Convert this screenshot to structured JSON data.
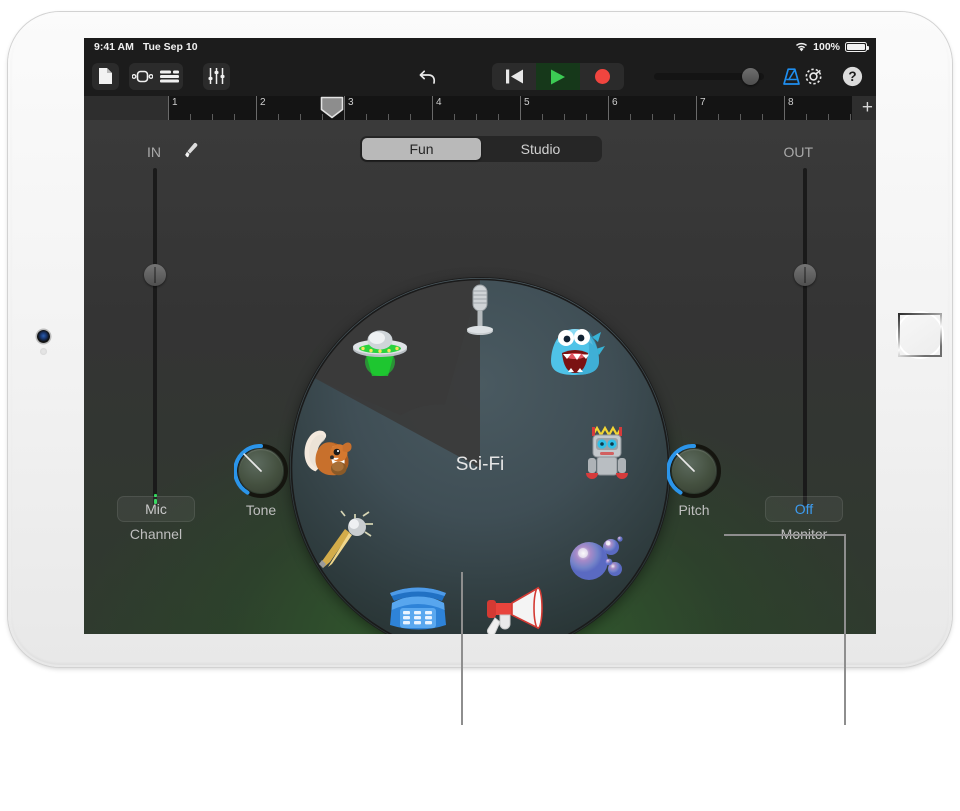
{
  "status_bar": {
    "time": "9:41 AM",
    "date": "Tue Sep 10",
    "battery_percent": "100%",
    "wifi_icon": "wifi-icon",
    "battery_icon": "battery-icon"
  },
  "toolbar": {
    "left_icons": [
      {
        "name": "document-icon",
        "label": "My Songs"
      },
      {
        "name": "track-view-icon",
        "label": "Track View"
      },
      {
        "name": "mixer-icon",
        "label": "Mixer"
      },
      {
        "name": "fader-controls-icon",
        "label": "Controls"
      }
    ],
    "undo_label": "Undo",
    "undo_icon": "undo-icon",
    "transport": [
      {
        "name": "rewind-button",
        "label": "Go to Beginning",
        "icon": "rewind-icon",
        "active": false
      },
      {
        "name": "play-button",
        "label": "Play",
        "icon": "play-icon",
        "active": true
      },
      {
        "name": "record-button",
        "label": "Record",
        "icon": "record-icon",
        "active": false
      }
    ],
    "volume_label": "Master Volume",
    "metronome_icon": "metronome-icon",
    "metronome_label": "Metronome",
    "settings_icon": "gear-icon",
    "settings_label": "Settings",
    "help_icon": "help-icon",
    "help_label": "Help"
  },
  "ruler": {
    "bars": [
      "1",
      "2",
      "3",
      "4",
      "5",
      "6",
      "7",
      "8"
    ],
    "playhead_bar": "3",
    "add_label": "+"
  },
  "channel_strip": {
    "in_label": "IN",
    "out_label": "OUT",
    "pencil_icon": "pencil-icon",
    "in_slider_name": "input-level-slider",
    "out_slider_name": "output-level-slider"
  },
  "segmented": {
    "options": [
      "Fun",
      "Studio"
    ],
    "selected": "Fun"
  },
  "dial": {
    "center_label": "Sci-Fi",
    "selected_index": 0,
    "presets": [
      {
        "index": 0,
        "name": "Sci-Fi",
        "icon": "ufo-icon",
        "selected": true
      },
      {
        "index": 1,
        "name": "Clean",
        "icon": "studio-microphone-icon",
        "selected": false
      },
      {
        "index": 2,
        "name": "Monster",
        "icon": "monster-icon",
        "selected": false
      },
      {
        "index": 3,
        "name": "Robot",
        "icon": "robot-icon",
        "selected": false
      },
      {
        "index": 4,
        "name": "Helium",
        "icon": "bubbles-icon",
        "selected": false
      },
      {
        "index": 5,
        "name": "Megaphone",
        "icon": "megaphone-icon",
        "selected": false
      },
      {
        "index": 6,
        "name": "Telephone",
        "icon": "telephone-icon",
        "selected": false
      },
      {
        "index": 7,
        "name": "Vocal Hall",
        "icon": "handheld-microphone-icon",
        "selected": false
      },
      {
        "index": 8,
        "name": "Chipmunk",
        "icon": "squirrel-icon",
        "selected": false
      }
    ]
  },
  "controls": {
    "channel_button": "Mic",
    "channel_label": "Channel",
    "tone_label": "Tone",
    "pitch_label": "Pitch",
    "monitor_button": "Off",
    "monitor_label": "Monitor"
  },
  "colors": {
    "accent_blue": "#3c9bf0",
    "record_red": "#f0453f",
    "play_green": "#3ccb54",
    "meter_green": "#2fd659",
    "panel_dark": "#1c1c1c"
  }
}
